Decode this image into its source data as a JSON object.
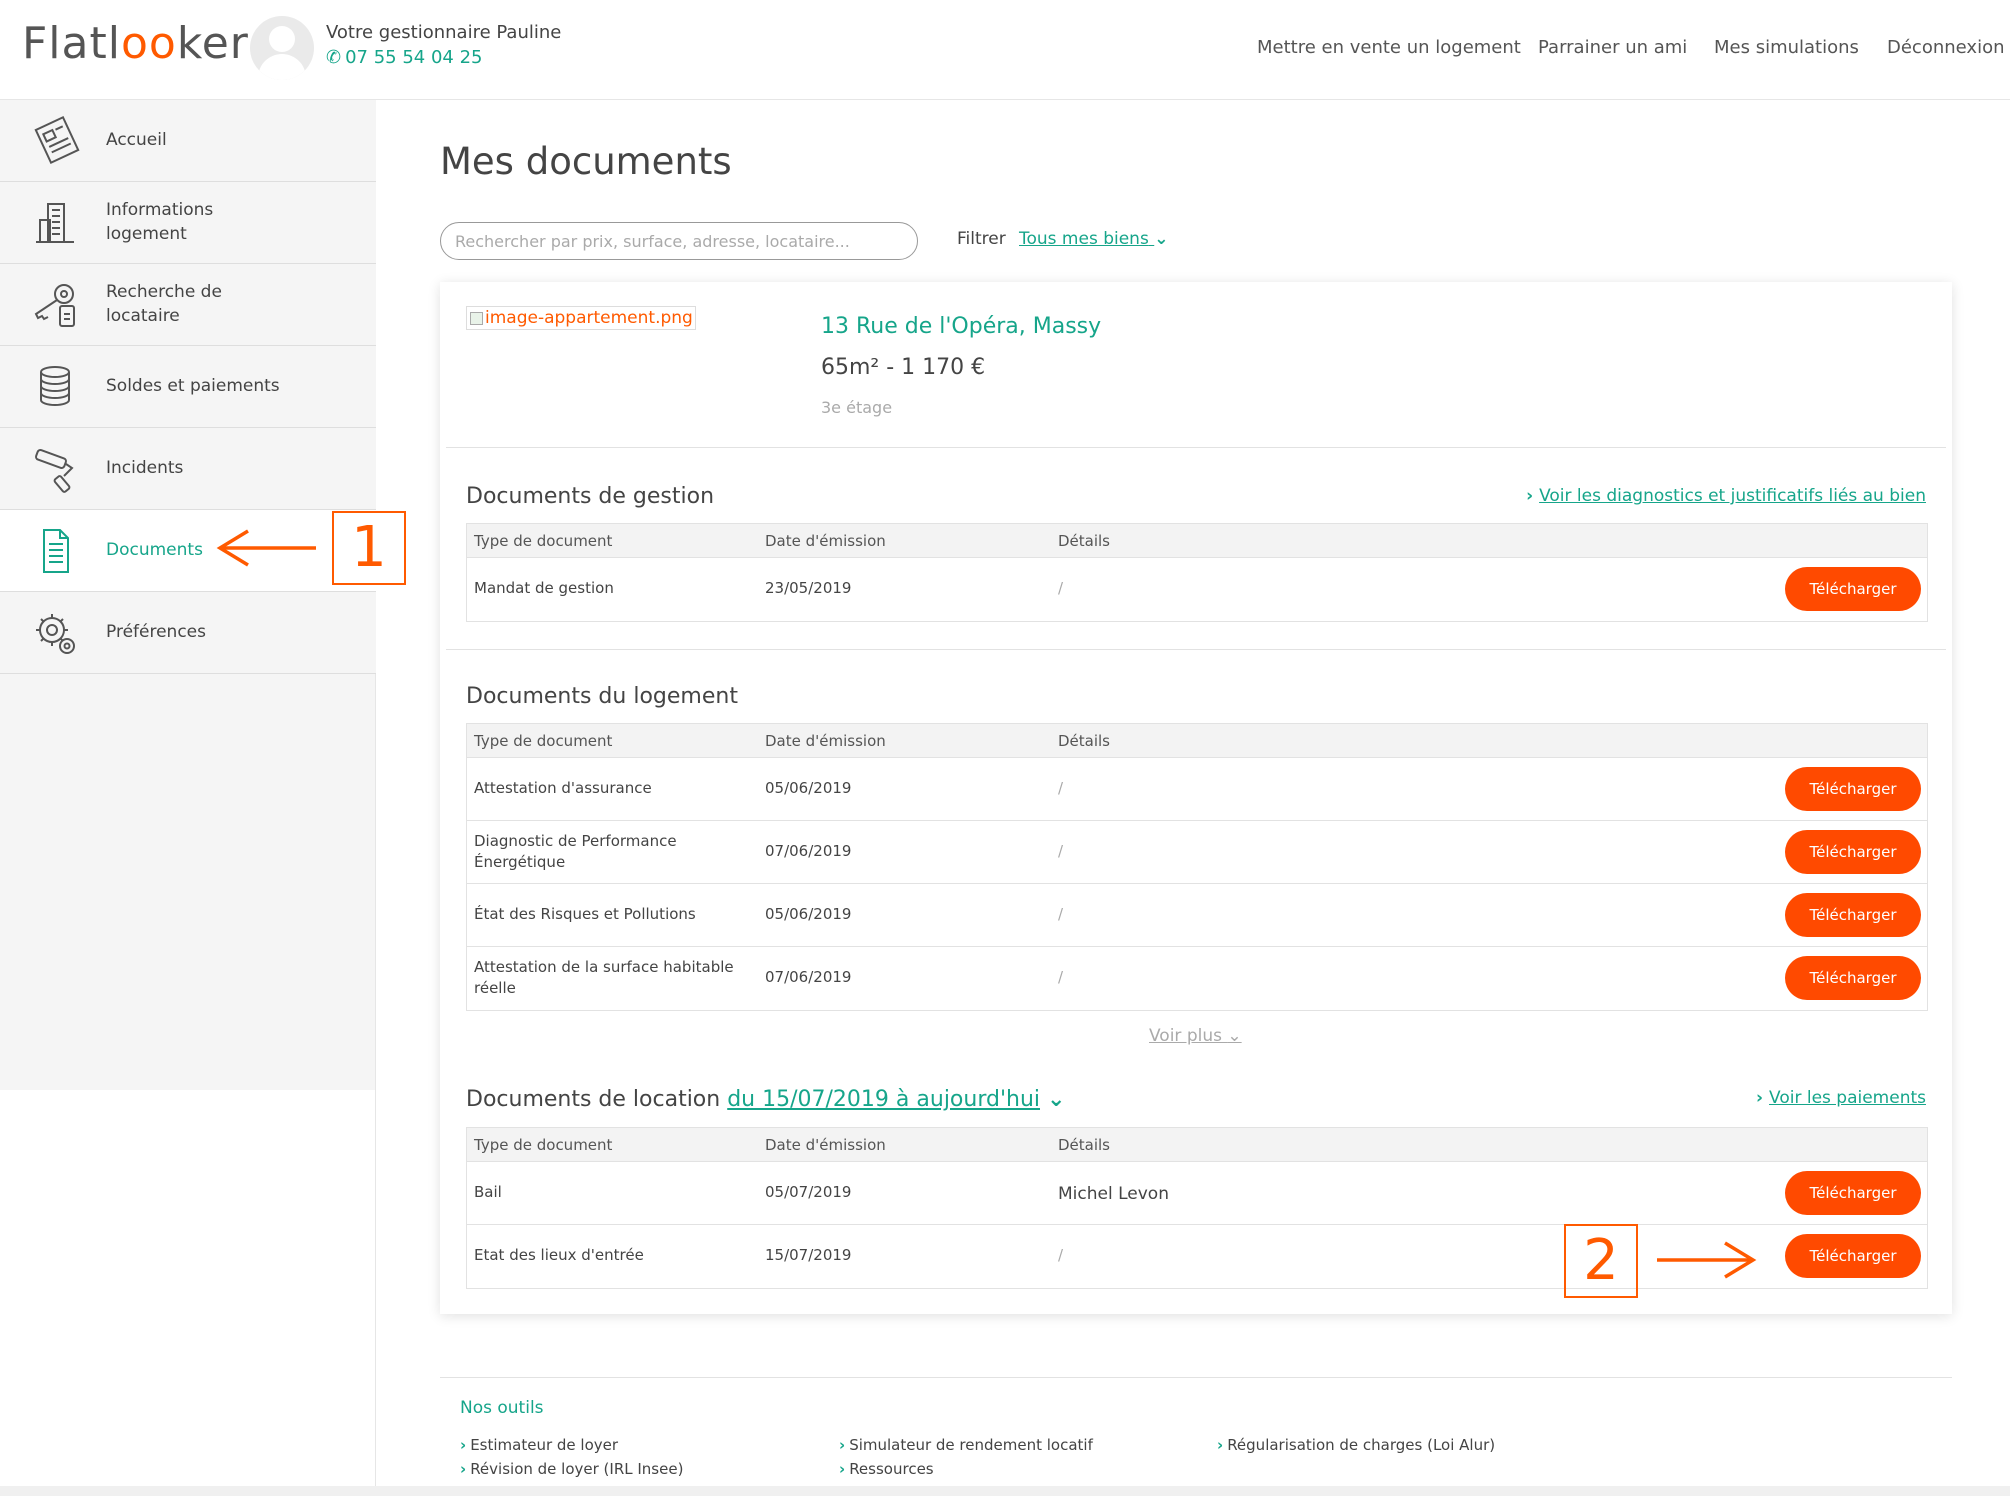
{
  "header": {
    "logo_text_start": "Flatl",
    "logo_text_oo": "oo",
    "logo_text_end": "ker",
    "manager_label": "Votre gestionnaire Pauline",
    "manager_phone": "07 55 54 04 25",
    "nav": [
      "Mettre en vente un logement",
      "Parrainer un ami",
      "Mes simulations",
      "Déconnexion"
    ]
  },
  "sidebar": {
    "items": [
      {
        "label": "Accueil",
        "icon": "newspaper-icon"
      },
      {
        "label": "Informations logement",
        "icon": "building-icon"
      },
      {
        "label": "Recherche de locataire",
        "icon": "keys-icon"
      },
      {
        "label": "Soldes et paiements",
        "icon": "coins-icon"
      },
      {
        "label": "Incidents",
        "icon": "paint-roller-icon"
      },
      {
        "label": "Documents",
        "icon": "document-icon",
        "active": true
      },
      {
        "label": "Préférences",
        "icon": "gears-icon"
      }
    ]
  },
  "annotations": {
    "one": "1",
    "two": "2"
  },
  "main": {
    "title": "Mes documents",
    "search_placeholder": "Rechercher par prix, surface, adresse, locataire...",
    "filter_label": "Filtrer",
    "filter_value": "Tous mes biens"
  },
  "property": {
    "image_alt": "image-appartement.png",
    "address": "13 Rue de l'Opéra, Massy",
    "surface_price": "65m² - 1 170 €",
    "floor": "3e étage"
  },
  "columns": {
    "type": "Type de document",
    "date": "Date d'émission",
    "details": "Détails"
  },
  "download_label": "Télécharger",
  "sections": {
    "gestion": {
      "title": "Documents de gestion",
      "link": "Voir les diagnostics et justificatifs liés au bien",
      "rows": [
        {
          "type": "Mandat de gestion",
          "date": "23/05/2019",
          "details": "/"
        }
      ]
    },
    "logement": {
      "title": "Documents du logement",
      "rows": [
        {
          "type": "Attestation d'assurance",
          "date": "05/06/2019",
          "details": "/"
        },
        {
          "type": "Diagnostic de Performance Énergétique",
          "date": "07/06/2019",
          "details": "/"
        },
        {
          "type": "État des Risques et Pollutions",
          "date": "05/06/2019",
          "details": "/"
        },
        {
          "type": "Attestation de la surface habitable réelle",
          "date": "07/06/2019",
          "details": "/"
        }
      ],
      "voir_plus": "Voir plus"
    },
    "location": {
      "title": "Documents de location",
      "period": "du 15/07/2019 à aujourd'hui",
      "link": "Voir les paiements",
      "rows": [
        {
          "type": "Bail",
          "date": "05/07/2019",
          "details": "Michel Levon"
        },
        {
          "type": "Etat des lieux d'entrée",
          "date": "15/07/2019",
          "details": "/"
        }
      ]
    }
  },
  "footer": {
    "title": "Nos outils",
    "links": [
      "Estimateur de loyer",
      "Révision de loyer (IRL Insee)",
      "Simulateur de rendement locatif",
      "Ressources",
      "Régularisation de charges (Loi Alur)"
    ]
  },
  "colors": {
    "accent": "#16a58a",
    "button": "#ff4a00",
    "annotation": "#ff5a00"
  }
}
